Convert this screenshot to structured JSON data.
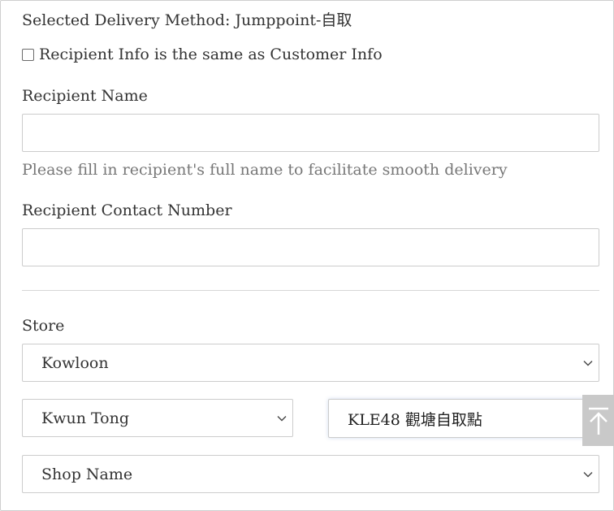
{
  "delivery": {
    "selected_method": "Selected Delivery Method: Jumppoint-自取"
  },
  "recipient": {
    "same_as_customer_label": "Recipient Info is the same as Customer Info",
    "same_as_customer_checked": false,
    "name_label": "Recipient Name",
    "name_value": "",
    "name_hint": "Please fill in recipient's full name to facilitate smooth delivery",
    "contact_label": "Recipient Contact Number",
    "contact_value": ""
  },
  "store": {
    "label": "Store",
    "region_selected": "Kowloon",
    "district_selected": "Kwun Tong",
    "pickup_point_selected": "KLE48 觀塘自取點",
    "shop_name_selected": "Shop Name"
  },
  "icons": {
    "chevron": "chevron-down-icon",
    "back_to_top": "arrow-up-to-top-icon"
  },
  "colors": {
    "back_to_top_bg": "#c9c9c9",
    "hint_text": "#777777"
  }
}
